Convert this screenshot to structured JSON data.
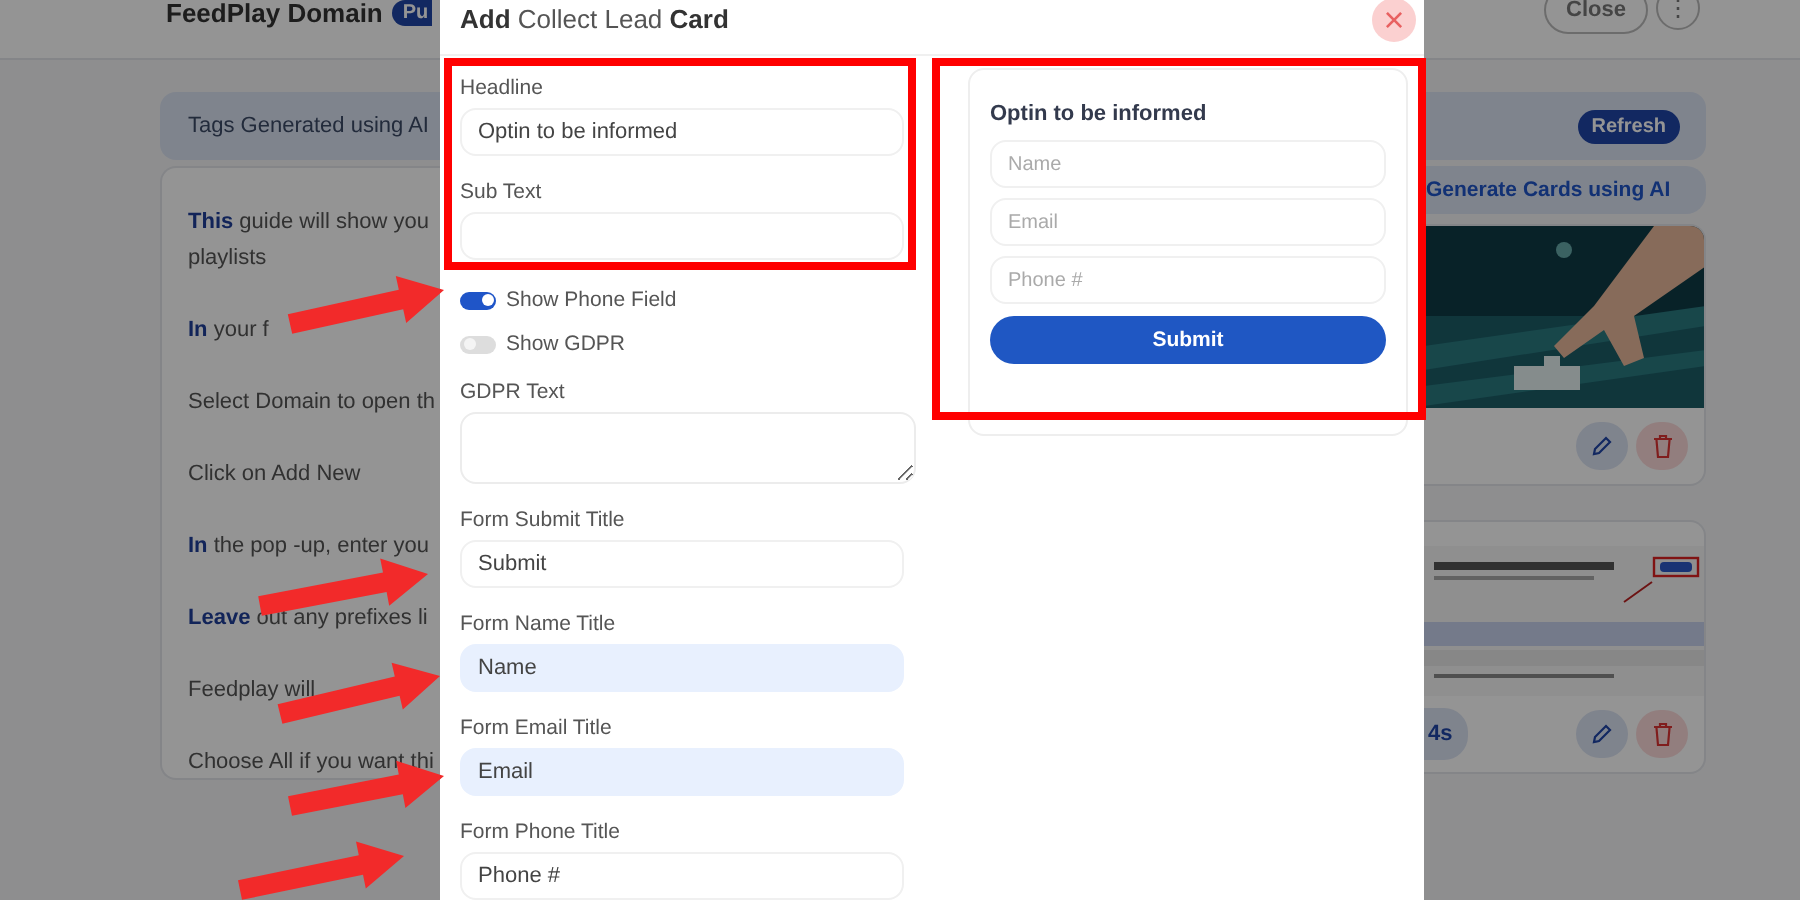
{
  "app": {
    "title": "FeedPlay Domain",
    "badge": "Pu",
    "close_button": "Close",
    "menu_button": "⋮"
  },
  "tags_bar": {
    "label": "Tags Generated using AI",
    "refresh_button": "Refresh"
  },
  "guide_steps": [
    {
      "lines": [
        "**This**  guide will show you",
        "playlists"
      ]
    },
    {
      "lines": [
        "**In**  your f"
      ]
    },
    {
      "lines": [
        "Select Domain to open th"
      ]
    },
    {
      "lines": [
        "Click on Add New"
      ]
    },
    {
      "lines": [
        "**In**  the pop -up, enter you"
      ]
    },
    {
      "lines": [
        "**Leave**  out any prefixes li"
      ]
    },
    {
      "lines": [
        "Feedplay will"
      ]
    },
    {
      "lines": [
        "Choose All if you want thi"
      ]
    }
  ],
  "generate_button": "Generate Cards using AI",
  "cards": [
    {
      "kind": "banner"
    },
    {
      "kind": "screenshot",
      "time_button": "4s"
    }
  ],
  "modal": {
    "title": "**Add** Collect Lead **Card**",
    "close_button": "×",
    "fields": [
      {
        "kind": "input",
        "label": "Headline",
        "value": "Optin to be informed",
        "autofilled": false
      },
      {
        "kind": "input",
        "label": "Sub Text",
        "autofilled": false
      },
      {
        "kind": "toggle",
        "label": "Show Phone Field",
        "on": true
      },
      {
        "kind": "toggle",
        "label": "Show GDPR",
        "on": false
      },
      {
        "kind": "textarea",
        "label": "GDPR Text"
      },
      {
        "kind": "input",
        "label": "Form Submit Title",
        "value": "Submit",
        "autofilled": false
      },
      {
        "kind": "input",
        "label": "Form Name Title",
        "value": "Name",
        "autofilled": true
      },
      {
        "kind": "input",
        "label": "Form Email Title",
        "value": "Email",
        "autofilled": true
      },
      {
        "kind": "input",
        "label": "Form Phone Title",
        "value": "Phone #",
        "autofilled": false
      }
    ],
    "preview": {
      "heading": "Optin to be informed",
      "fields": [
        {
          "placeholder": "Name"
        },
        {
          "placeholder": "Email"
        },
        {
          "placeholder": "Phone #"
        }
      ],
      "submit_button": "Submit"
    }
  }
}
